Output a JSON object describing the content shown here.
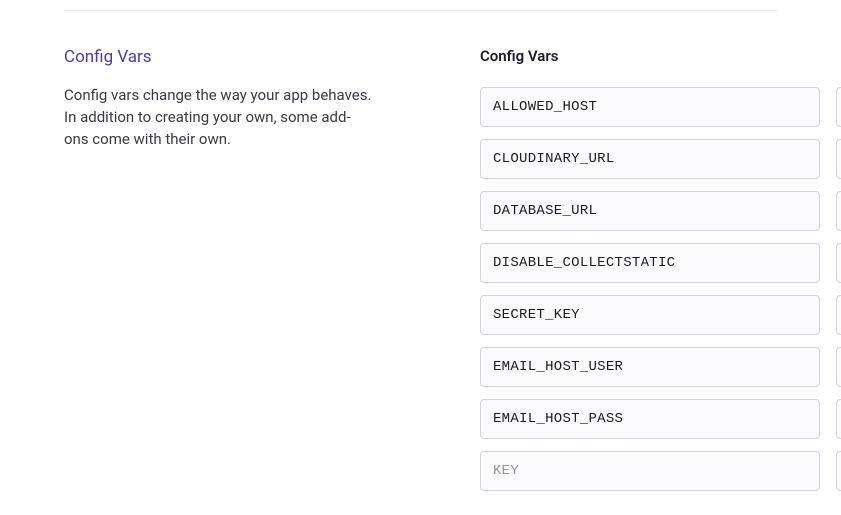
{
  "left": {
    "title": "Config Vars",
    "desc": "Config vars change the way your app behaves. In addition to creating your own, some add-ons come with their own."
  },
  "right": {
    "title": "Config Vars",
    "vars": [
      {
        "key": "ALLOWED_HOST"
      },
      {
        "key": "CLOUDINARY_URL"
      },
      {
        "key": "DATABASE_URL"
      },
      {
        "key": "DISABLE_COLLECTSTATIC"
      },
      {
        "key": "SECRET_KEY"
      },
      {
        "key": "EMAIL_HOST_USER"
      },
      {
        "key": "EMAIL_HOST_PASS"
      }
    ],
    "new_key_placeholder": "KEY"
  }
}
